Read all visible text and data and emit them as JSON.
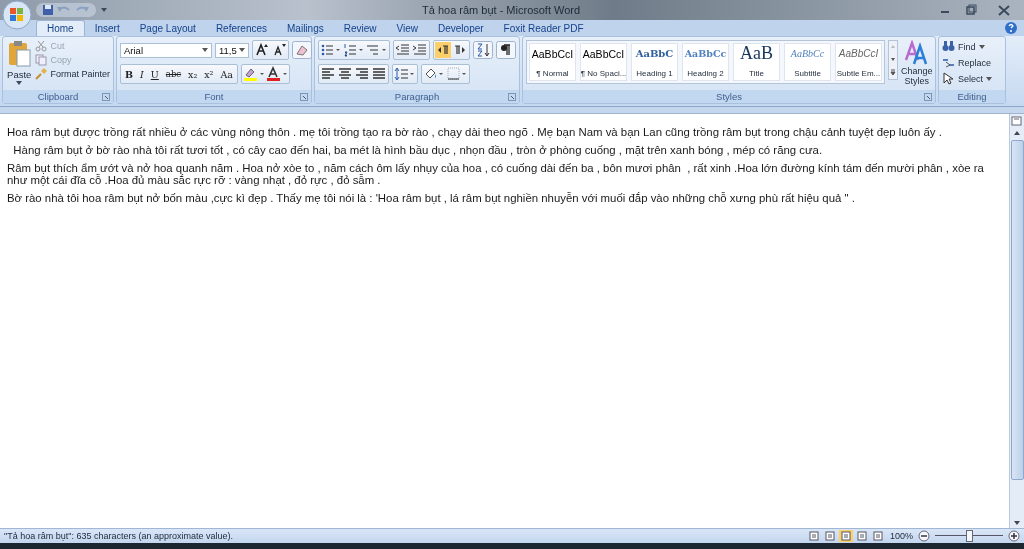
{
  "window": {
    "title": "Tả hoa râm bụt - Microsoft Word"
  },
  "tabs": [
    {
      "label": "Home",
      "selected": true
    },
    {
      "label": "Insert",
      "selected": false
    },
    {
      "label": "Page Layout",
      "selected": false
    },
    {
      "label": "References",
      "selected": false
    },
    {
      "label": "Mailings",
      "selected": false
    },
    {
      "label": "Review",
      "selected": false
    },
    {
      "label": "View",
      "selected": false
    },
    {
      "label": "Developer",
      "selected": false
    },
    {
      "label": "Foxit Reader PDF",
      "selected": false
    }
  ],
  "clipboard": {
    "label": "Clipboard",
    "paste": "Paste",
    "items": [
      {
        "label": "Cut",
        "disabled": true
      },
      {
        "label": "Copy",
        "disabled": true
      },
      {
        "label": "Format Painter",
        "disabled": false
      }
    ]
  },
  "font": {
    "label": "Font",
    "font_name": "Arial",
    "font_size": "11,5",
    "format_buttons": [
      "B",
      "I",
      "U",
      "abc",
      "x₂",
      "x²",
      "Aa"
    ]
  },
  "paragraph": {
    "label": "Paragraph"
  },
  "styles": {
    "label": "Styles",
    "items": [
      {
        "preview": "AaBbCcI",
        "name": "¶ Normal",
        "kind": "normal"
      },
      {
        "preview": "AaBbCcI",
        "name": "¶ No Spaci...",
        "kind": "normal"
      },
      {
        "preview": "AaBbC",
        "name": "Heading 1",
        "kind": "heading1"
      },
      {
        "preview": "AaBbCc",
        "name": "Heading 2",
        "kind": "heading2"
      },
      {
        "preview": "AaB",
        "name": "Title",
        "kind": "title"
      },
      {
        "preview": "AaBbCc",
        "name": "Subtitle",
        "kind": "subtitle"
      },
      {
        "preview": "AaBbCcI",
        "name": "Subtle Em...",
        "kind": "emphasis"
      }
    ],
    "change_styles": "Change Styles"
  },
  "editing": {
    "label": "Editing",
    "items": [
      "Find",
      "Replace",
      "Select"
    ]
  },
  "document": {
    "paragraphs": [
      "Hoa râm bụt được trồng rất nhiều ở các vùng nông thôn . mẹ tôi trồng tạo ra bờ rào , chạy dài theo ngõ . Mẹ bạn Nam và bạn Lan cũng trồng râm bụt trong chậu cảnh tuyệt đẹp luôn ấy .",
      "  Hàng râm bụt ở bờ rào nhà tôi rất tươi tốt , có cây cao đến hai, ba mét là hình bầu dục , nhọn đầu , tròn ở phòng cuống , mặt trên xanh bóng , mép có răng cưa.",
      "Râm bụt thích ẩm ướt và nở hoa quanh năm . Hoa nở xòe to , năm cách ôm lấy nhụy của hoa , có cuống dài đến ba , bôn mươi phân  , rất xinh .Hoa lớn đường kính tám đến mười phân , xòe ra như một cái đĩa cỗ .Hoa đủ màu sắc rực rỡ : vàng nhạt , đỏ rực , đỏ sẫm .",
      "Bờ rào nhà tôi hoa râm bụt nở bốn màu ,cực kì đẹp . Thấy mẹ tôi nói là : 'Hoa râm bụt , lá râm bụt nghiền nhuyễn với muối đắp vào những chỗ xưng phù rất hiệu quả \" ."
    ]
  },
  "status_bar": {
    "text": "\"Tả hoa râm bụt\": 635 characters (an approximate value).",
    "views": [
      {
        "selected": false
      },
      {
        "selected": false
      },
      {
        "selected": true
      },
      {
        "selected": false
      },
      {
        "selected": false
      }
    ],
    "zoom": "100%",
    "zoom_slider": {
      "level": 0.5
    }
  }
}
